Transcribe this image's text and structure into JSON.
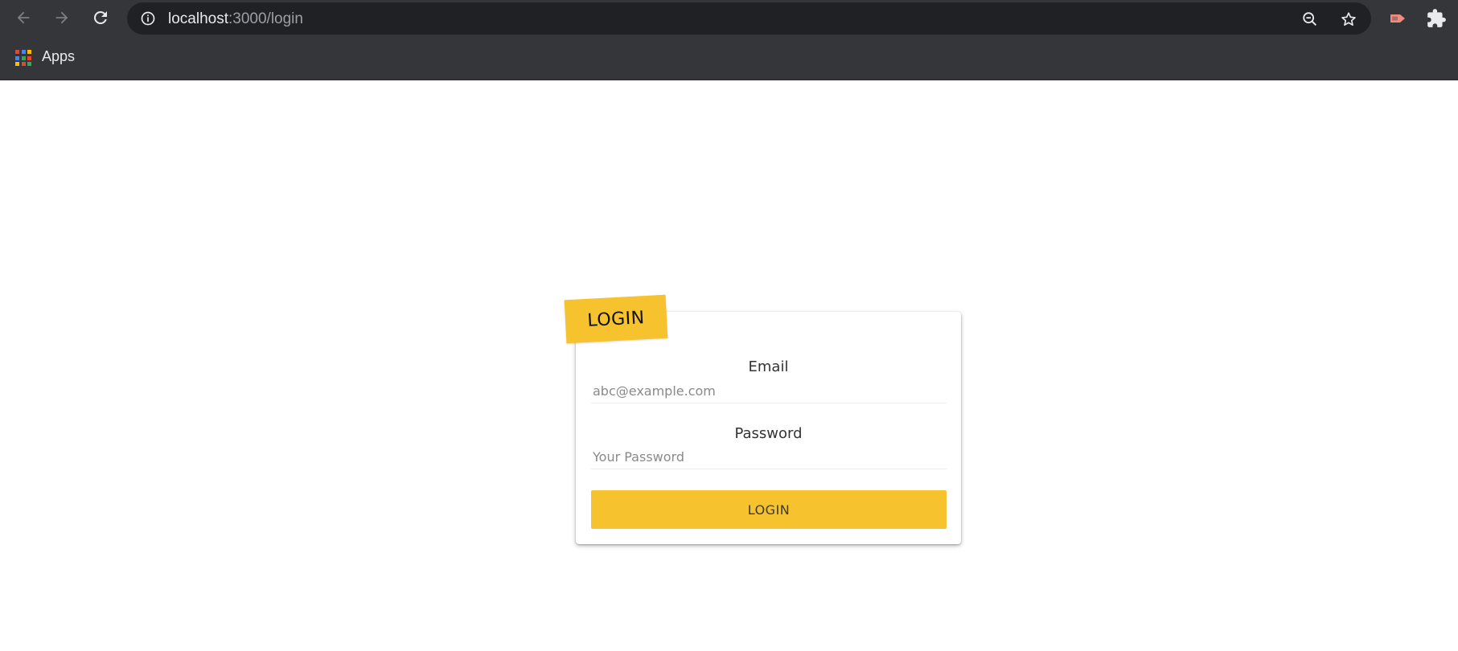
{
  "browser": {
    "url_host": "localhost",
    "url_path": ":3000/login",
    "bookmarks": {
      "apps_label": "Apps"
    },
    "icons": {
      "back": "arrow-left-icon",
      "forward": "arrow-right-icon",
      "reload": "reload-icon",
      "info": "info-icon",
      "zoom": "zoom-out-icon",
      "star": "star-icon",
      "extension": "extension-icon",
      "puzzle": "puzzle-icon",
      "apps": "apps-grid-icon"
    }
  },
  "login": {
    "badge": "LOGIN",
    "email_label": "Email",
    "email_placeholder": "abc@example.com",
    "email_value": "",
    "password_label": "Password",
    "password_placeholder": "Your Password",
    "password_value": "",
    "submit_label": "LOGIN"
  },
  "colors": {
    "accent": "#f6c22d",
    "chrome_bg": "#35363a",
    "omnibox_bg": "#202124"
  }
}
